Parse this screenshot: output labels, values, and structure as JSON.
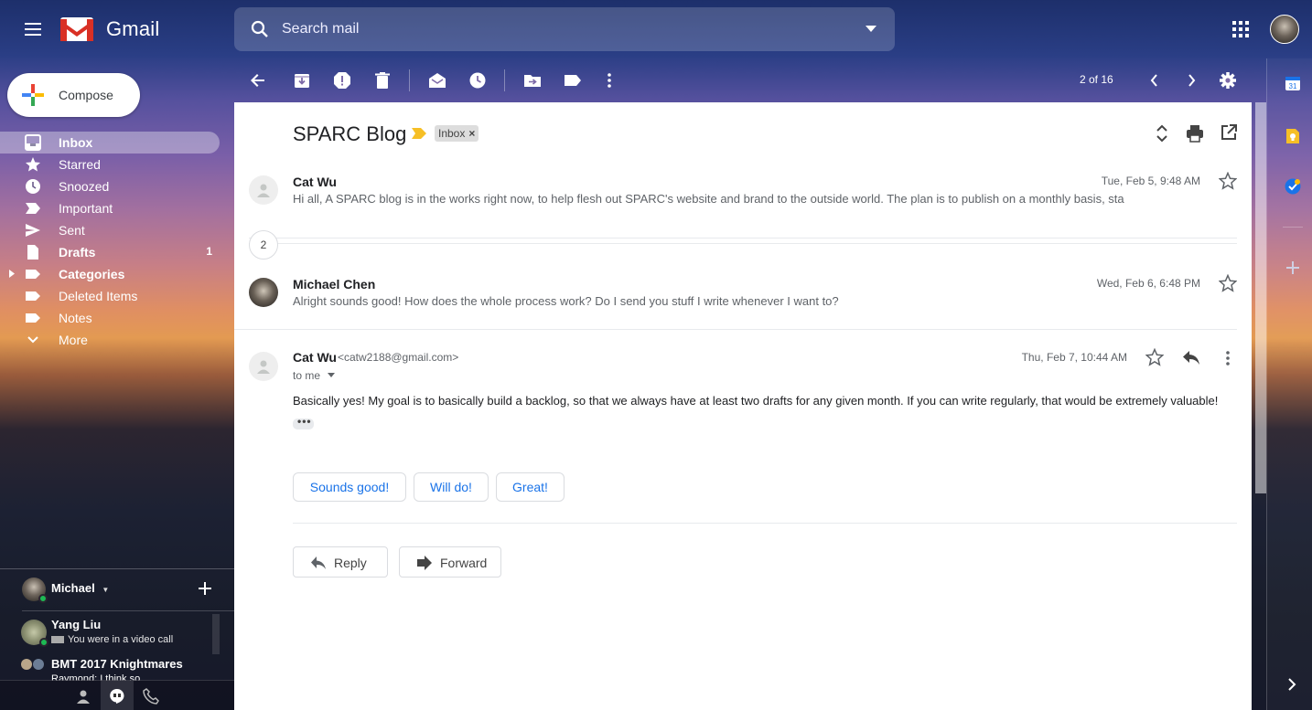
{
  "header": {
    "app_name": "Gmail",
    "search_placeholder": "Search mail"
  },
  "compose_label": "Compose",
  "nav": [
    {
      "label": "Inbox",
      "count": "",
      "icon": "inbox-icon"
    },
    {
      "label": "Starred",
      "count": "",
      "icon": "star-icon"
    },
    {
      "label": "Snoozed",
      "count": "",
      "icon": "clock-icon"
    },
    {
      "label": "Important",
      "count": "",
      "icon": "important-icon"
    },
    {
      "label": "Sent",
      "count": "",
      "icon": "send-icon"
    },
    {
      "label": "Drafts",
      "count": "1",
      "icon": "draft-icon"
    },
    {
      "label": "Categories",
      "count": "",
      "icon": "label-icon"
    },
    {
      "label": "Deleted Items",
      "count": "",
      "icon": "label-icon"
    },
    {
      "label": "Notes",
      "count": "",
      "icon": "label-icon"
    },
    {
      "label": "More",
      "count": "",
      "icon": "chevron-down-icon"
    }
  ],
  "hangouts": {
    "me_name": "Michael",
    "contacts": [
      {
        "name": "Yang Liu",
        "status": "You were in a video call"
      },
      {
        "name": "BMT 2017 Knightmares",
        "status": "Raymond: I think so"
      }
    ]
  },
  "toolbar": {
    "pager": "2 of 16"
  },
  "thread": {
    "subject": "SPARC Blog",
    "label_chip": "Inbox",
    "collapsed_count": "2",
    "messages": [
      {
        "sender": "Cat Wu",
        "date": "Tue, Feb 5, 9:48 AM",
        "snippet": "Hi all, A SPARC blog is in the works right now, to help flesh out SPARC's website and brand to the outside world. The plan is to publish on a monthly basis, sta"
      },
      {
        "sender": "Michael Chen",
        "date": "Wed, Feb 6, 6:48 PM",
        "snippet": "Alright sounds good! How does the whole process work? Do I send you stuff I write whenever I want to?"
      },
      {
        "sender": "Cat Wu",
        "email": "<catw2188@gmail.com>",
        "to": "to me",
        "date": "Thu, Feb 7, 10:44 AM",
        "body": "Basically yes! My goal is to basically build a backlog, so that we always have at least two drafts for any given month. If you can write regularly, that would be extremely valuable!"
      }
    ],
    "smart_replies": [
      "Sounds good!",
      "Will do!",
      "Great!"
    ],
    "reply_label": "Reply",
    "forward_label": "Forward"
  },
  "colors": {
    "accent_blue": "#1a73e8",
    "label_yellow": "#f6bf26"
  }
}
